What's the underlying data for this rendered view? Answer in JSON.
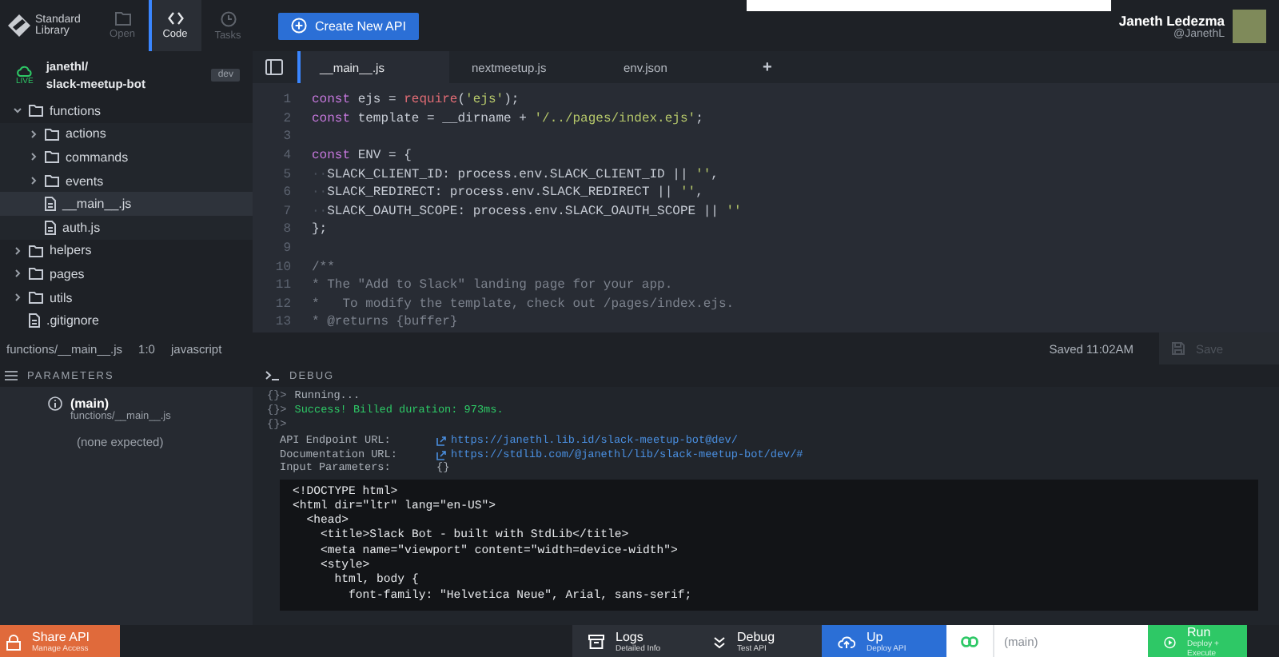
{
  "brand": {
    "line_1": "Standard",
    "line_2": "Library"
  },
  "nav": [
    {
      "label": "Open",
      "selected": false,
      "kind": "folder"
    },
    {
      "label": "Code",
      "selected": true,
      "kind": "code"
    },
    {
      "label": "Tasks",
      "selected": false,
      "kind": "clock"
    }
  ],
  "create_button": {
    "label": "Create New API"
  },
  "user": {
    "name": "Janeth Ledezma",
    "handle": "@JanethL"
  },
  "project": {
    "status": "LIVE",
    "owner": "janethl/",
    "name": "slack-meetup-bot",
    "env": "dev"
  },
  "tree": [
    {
      "label": "functions",
      "kind": "folder",
      "expanded": true,
      "selected": false,
      "children": [
        {
          "label": "actions",
          "kind": "folder",
          "expanded": false,
          "selected": false
        },
        {
          "label": "commands",
          "kind": "folder",
          "expanded": false,
          "selected": false
        },
        {
          "label": "events",
          "kind": "folder",
          "expanded": false,
          "selected": false
        },
        {
          "label": "__main__.js",
          "kind": "file",
          "selected": true
        },
        {
          "label": "auth.js",
          "kind": "file",
          "selected": false
        }
      ]
    },
    {
      "label": "helpers",
      "kind": "folder",
      "expanded": false,
      "selected": false
    },
    {
      "label": "pages",
      "kind": "folder",
      "expanded": false,
      "selected": false
    },
    {
      "label": "utils",
      "kind": "folder",
      "expanded": false,
      "selected": false
    },
    {
      "label": ".gitignore",
      "kind": "file",
      "selected": false
    }
  ],
  "editor_tabs": [
    {
      "label": "__main__.js",
      "selected": true
    },
    {
      "label": "nextmeetup.js",
      "selected": false
    },
    {
      "label": "env.json",
      "selected": false
    }
  ],
  "add_tab": "+",
  "code_lines": [
    {
      "number": "1",
      "segments": [
        {
          "kind": "keyword",
          "text": "const"
        },
        {
          "kind": "plain",
          "text": " ejs = "
        },
        {
          "kind": "call",
          "text": "require"
        },
        {
          "kind": "plain",
          "text": "("
        },
        {
          "kind": "string",
          "text": "'ejs'"
        },
        {
          "kind": "plain",
          "text": ");"
        }
      ]
    },
    {
      "number": "2",
      "segments": [
        {
          "kind": "keyword",
          "text": "const"
        },
        {
          "kind": "plain",
          "text": " template = __dirname + "
        },
        {
          "kind": "string",
          "text": "'/../pages/index.ejs'"
        },
        {
          "kind": "plain",
          "text": ";"
        }
      ]
    },
    {
      "number": "3"
    },
    {
      "number": "4",
      "segments": [
        {
          "kind": "keyword",
          "text": "const"
        },
        {
          "kind": "plain",
          "text": " ENV = {"
        }
      ]
    },
    {
      "number": "5",
      "segments": [
        {
          "kind": "whitespace",
          "text": "··"
        },
        {
          "kind": "plain",
          "text": "SLACK_CLIENT_ID: process.env.SLACK_CLIENT_ID || "
        },
        {
          "kind": "string",
          "text": "''"
        },
        {
          "kind": "plain",
          "text": ","
        }
      ]
    },
    {
      "number": "6",
      "segments": [
        {
          "kind": "whitespace",
          "text": "··"
        },
        {
          "kind": "plain",
          "text": "SLACK_REDIRECT: process.env.SLACK_REDIRECT || "
        },
        {
          "kind": "string",
          "text": "''"
        },
        {
          "kind": "plain",
          "text": ","
        }
      ]
    },
    {
      "number": "7",
      "segments": [
        {
          "kind": "whitespace",
          "text": "··"
        },
        {
          "kind": "plain",
          "text": "SLACK_OAUTH_SCOPE: process.env.SLACK_OAUTH_SCOPE || "
        },
        {
          "kind": "string",
          "text": "''"
        }
      ]
    },
    {
      "number": "8",
      "segments": [
        {
          "kind": "plain",
          "text": "};"
        }
      ]
    },
    {
      "number": "9"
    },
    {
      "number": "10",
      "segments": [
        {
          "kind": "comment",
          "text": "/**"
        }
      ]
    },
    {
      "number": "11",
      "segments": [
        {
          "kind": "comment",
          "text": "* The \"Add to Slack\" landing page for your app."
        }
      ]
    },
    {
      "number": "12",
      "segments": [
        {
          "kind": "comment",
          "text": "*   To modify the template, check out /pages/index.ejs."
        }
      ]
    },
    {
      "number": "13",
      "segments": [
        {
          "kind": "comment",
          "text": "* @returns {buffer}"
        }
      ]
    }
  ],
  "status_bar": {
    "path": "functions/__main__.js",
    "position": "1:0",
    "language": "javascript",
    "saved": "Saved 11:02AM",
    "save_button": {
      "label": "Save",
      "disabled": true
    }
  },
  "parameters": {
    "title": "PARAMETERS",
    "function_name": "(main)",
    "function_path": "functions/__main__.js",
    "note": "(none expected)"
  },
  "debug": {
    "title": "DEBUG",
    "log": [
      {
        "prompt": "{}>",
        "text": "Running...",
        "kind": "info"
      },
      {
        "prompt": "{}>",
        "text": "Success! Billed duration: 973ms.",
        "kind": "success"
      },
      {
        "prompt": "{}>"
      }
    ],
    "info": [
      {
        "label": "API Endpoint URL:",
        "value": "https://janethl.lib.id/slack-meetup-bot@dev/",
        "link": true
      },
      {
        "label": "Documentation URL:",
        "value": "https://stdlib.com/@janethl/lib/slack-meetup-bot/dev/#",
        "link": true
      },
      {
        "label": "Input Parameters:",
        "value": "{}",
        "link": false
      }
    ],
    "output": [
      "<!DOCTYPE html>",
      "<html dir=\"ltr\" lang=\"en-US\">",
      "  <head>",
      "    <title>Slack Bot - built with StdLib</title>",
      "    <meta name=\"viewport\" content=\"width=device-width\">",
      "    <style>",
      "      html, body {",
      "        font-family: \"Helvetica Neue\", Arial, sans-serif;"
    ]
  },
  "bottom_bar": {
    "share": {
      "label": "Share API",
      "sub": "Manage Access",
      "kind": "share"
    },
    "actions": [
      {
        "label": "Logs",
        "sub": "Detailed Info",
        "kind": "logs"
      },
      {
        "label": "Debug",
        "sub": "Test API",
        "kind": "debug"
      },
      {
        "label": "Up",
        "sub": "Deploy API",
        "kind": "up"
      }
    ],
    "function_field": {
      "placeholder": "(main)"
    },
    "run": {
      "label": "Run",
      "sub": "Deploy + Execute",
      "kind": "run"
    }
  }
}
